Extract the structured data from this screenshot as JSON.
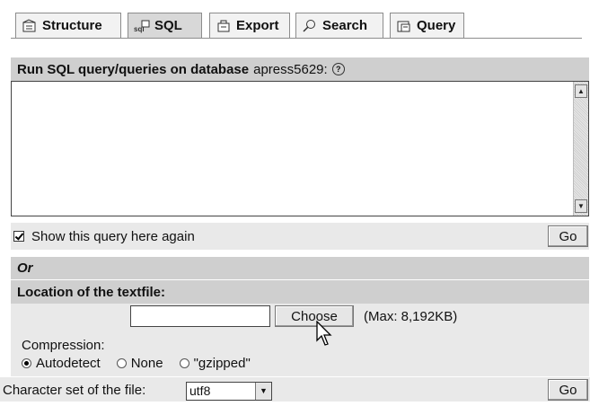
{
  "tabs": [
    {
      "label": "Structure",
      "icon": "structure-icon",
      "active": false
    },
    {
      "label": "SQL",
      "icon": "sql-icon",
      "active": true
    },
    {
      "label": "Export",
      "icon": "export-icon",
      "active": false
    },
    {
      "label": "Search",
      "icon": "search-icon",
      "active": false
    },
    {
      "label": "Query",
      "icon": "query-icon",
      "active": false
    }
  ],
  "sql_panel": {
    "title_prefix": "Run SQL query/queries on database",
    "database": "apress5629:",
    "help_icon": "?",
    "query_value": "",
    "show_again_label": "Show this query here again",
    "show_again_checked": true,
    "go_label": "Go"
  },
  "or_label": "Or",
  "textfile": {
    "heading": "Location of the textfile:",
    "file_value": "",
    "choose_label": "Choose",
    "max_label": "(Max: 8,192KB)",
    "compression_label": "Compression:",
    "compression_options": [
      "Autodetect",
      "None",
      "\"gzipped\""
    ],
    "compression_selected": "Autodetect",
    "charset_label": "Character set of the file:",
    "charset_value": "utf8",
    "go_label": "Go"
  }
}
